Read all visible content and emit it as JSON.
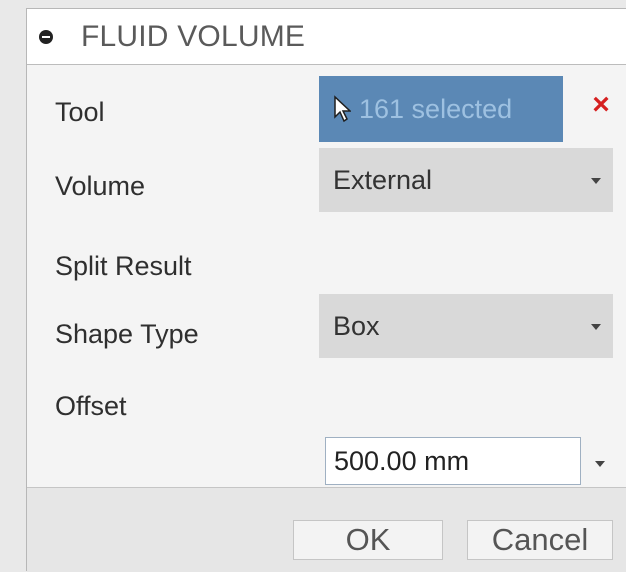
{
  "panel": {
    "title": "FLUID VOLUME"
  },
  "rows": {
    "tool": {
      "label": "Tool",
      "selection_text": "161 selected"
    },
    "volume": {
      "label": "Volume",
      "value": "External"
    },
    "split_result": {
      "label": "Split Result",
      "checked": false
    },
    "shape_type": {
      "label": "Shape Type",
      "value": "Box"
    },
    "offset": {
      "label": "Offset",
      "value": "500.00 mm"
    }
  },
  "footer": {
    "ok_label": "OK",
    "cancel_label": "Cancel"
  },
  "icons": {
    "collapse": "collapse-icon",
    "select": "cursor-icon",
    "remove": "close-icon",
    "dropdown": "chevron-down-icon"
  },
  "colors": {
    "selection_background": "#5b88b5",
    "selection_text": "#9ec1e1",
    "remove": "#d62020",
    "panel_background": "#f4f4f4",
    "dropdown_background": "#d9d9d9"
  }
}
